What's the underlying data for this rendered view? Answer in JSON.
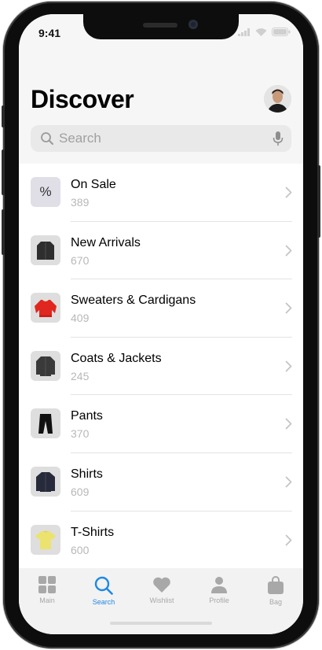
{
  "status": {
    "time": "9:41"
  },
  "header": {
    "title": "Discover"
  },
  "search": {
    "placeholder": "Search"
  },
  "categories": [
    {
      "label": "On Sale",
      "count": "389",
      "icon": "percent-icon"
    },
    {
      "label": "New Arrivals",
      "count": "670",
      "icon": "jacket-icon"
    },
    {
      "label": "Sweaters & Cardigans",
      "count": "409",
      "icon": "sweater-icon"
    },
    {
      "label": "Coats & Jackets",
      "count": "245",
      "icon": "coat-icon"
    },
    {
      "label": "Pants",
      "count": "370",
      "icon": "pants-icon"
    },
    {
      "label": "Shirts",
      "count": "609",
      "icon": "shirt-icon"
    },
    {
      "label": "T-Shirts",
      "count": "600",
      "icon": "tshirt-icon"
    }
  ],
  "percent_symbol": "%",
  "tabs": [
    {
      "label": "Main",
      "icon": "grid-icon",
      "active": false
    },
    {
      "label": "Search",
      "icon": "search-icon",
      "active": true
    },
    {
      "label": "Wishlist",
      "icon": "heart-icon",
      "active": false
    },
    {
      "label": "Profile",
      "icon": "person-icon",
      "active": false
    },
    {
      "label": "Bag",
      "icon": "bag-icon",
      "active": false
    }
  ],
  "colors": {
    "accent": "#1e88e5",
    "inactive": "#a8a8a8",
    "header_bg": "#f6f6f6"
  }
}
